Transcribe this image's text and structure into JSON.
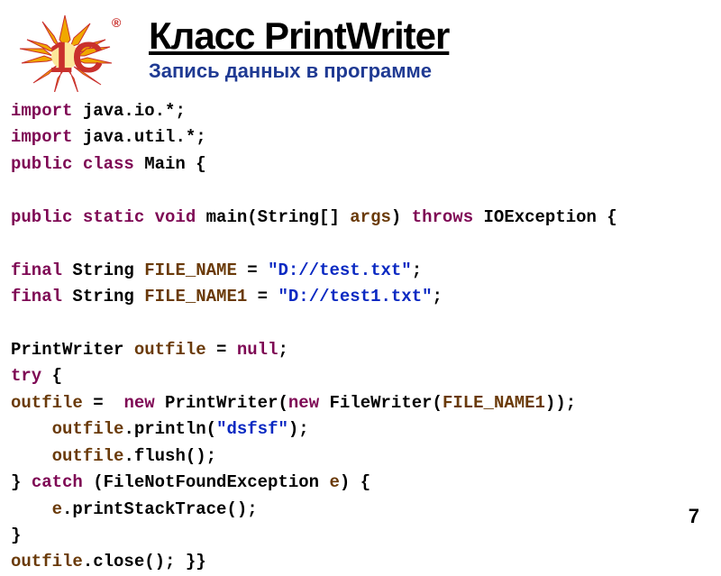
{
  "title": "Класс PrintWriter",
  "subtitle": "Запись данных в программе",
  "logo": {
    "digit": "1",
    "letter": "С",
    "reg": "®"
  },
  "code": {
    "tokens": [
      [
        [
          "kw",
          "import"
        ],
        [
          "",
          " java.io.*;"
        ]
      ],
      [
        [
          "kw",
          "import"
        ],
        [
          "",
          " java.util.*;"
        ]
      ],
      [
        [
          "kw",
          "public class"
        ],
        [
          "",
          " Main {"
        ]
      ],
      [
        [
          "",
          ""
        ]
      ],
      [
        [
          "kw",
          "public static void"
        ],
        [
          "",
          " main(String[] "
        ],
        [
          "var",
          "args"
        ],
        [
          "",
          ") "
        ],
        [
          "kw",
          "throws"
        ],
        [
          "",
          " IOException {"
        ]
      ],
      [
        [
          "",
          ""
        ]
      ],
      [
        [
          "kw",
          "final"
        ],
        [
          "",
          " String "
        ],
        [
          "var",
          "FILE_NAME"
        ],
        [
          "",
          " = "
        ],
        [
          "str",
          "\"D://test.txt\""
        ],
        [
          "",
          ";"
        ]
      ],
      [
        [
          "kw",
          "final"
        ],
        [
          "",
          " String "
        ],
        [
          "var",
          "FILE_NAME1"
        ],
        [
          "",
          " = "
        ],
        [
          "str",
          "\"D://test1.txt\""
        ],
        [
          "",
          ";"
        ]
      ],
      [
        [
          "",
          ""
        ]
      ],
      [
        [
          "",
          "PrintWriter "
        ],
        [
          "var",
          "outfile"
        ],
        [
          "",
          " = "
        ],
        [
          "kw",
          "null"
        ],
        [
          "",
          ";"
        ]
      ],
      [
        [
          "kw",
          "try"
        ],
        [
          "",
          " {"
        ]
      ],
      [
        [
          "var",
          "outfile"
        ],
        [
          "",
          " =  "
        ],
        [
          "kw",
          "new"
        ],
        [
          "",
          " PrintWriter("
        ],
        [
          "kw",
          "new"
        ],
        [
          "",
          " FileWriter("
        ],
        [
          "var",
          "FILE_NAME1"
        ],
        [
          "",
          "));"
        ]
      ],
      [
        [
          "",
          "    "
        ],
        [
          "var",
          "outfile"
        ],
        [
          "",
          ".println("
        ],
        [
          "str",
          "\"dsfsf\""
        ],
        [
          "",
          ");"
        ]
      ],
      [
        [
          "",
          "    "
        ],
        [
          "var",
          "outfile"
        ],
        [
          "",
          ".flush();"
        ]
      ],
      [
        [
          "",
          "} "
        ],
        [
          "kw",
          "catch"
        ],
        [
          "",
          " (FileNotFoundException "
        ],
        [
          "var",
          "e"
        ],
        [
          "",
          ") {"
        ]
      ],
      [
        [
          "",
          "    "
        ],
        [
          "var",
          "e"
        ],
        [
          "",
          ".printStackTrace();"
        ]
      ],
      [
        [
          "",
          "}"
        ]
      ],
      [
        [
          "var",
          "outfile"
        ],
        [
          "",
          ".close(); }}"
        ]
      ]
    ]
  },
  "page_number": "7"
}
